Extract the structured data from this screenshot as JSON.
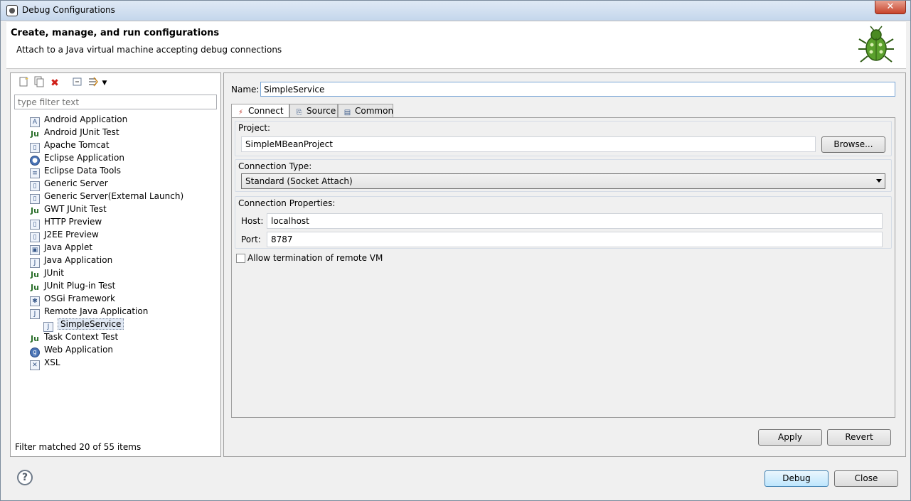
{
  "window": {
    "title": "Debug Configurations",
    "close_glyph": "✕"
  },
  "header": {
    "title": "Create, manage, and run configurations",
    "subtitle": "Attach to a Java virtual machine accepting debug connections"
  },
  "left": {
    "filter_placeholder": "type filter text",
    "status": "Filter matched 20 of 55 items",
    "toolbar_icons": [
      "new-config-icon",
      "duplicate-icon",
      "delete-icon",
      "collapse-all-icon",
      "filter-icon",
      "dropdown-arrow-icon"
    ],
    "tree": [
      {
        "label": "Android Application",
        "icon": "android-app-icon",
        "glyph": "A"
      },
      {
        "label": "Android JUnit Test",
        "icon": "junit-icon",
        "glyph": "Ju"
      },
      {
        "label": "Apache Tomcat",
        "icon": "server-icon",
        "glyph": "▯"
      },
      {
        "label": "Eclipse Application",
        "icon": "eclipse-icon",
        "glyph": "●"
      },
      {
        "label": "Eclipse Data Tools",
        "icon": "database-icon",
        "glyph": "≡"
      },
      {
        "label": "Generic Server",
        "icon": "server-icon",
        "glyph": "▯"
      },
      {
        "label": "Generic Server(External Launch)",
        "icon": "server-icon",
        "glyph": "▯"
      },
      {
        "label": "GWT JUnit Test",
        "icon": "junit-icon",
        "glyph": "Ju"
      },
      {
        "label": "HTTP Preview",
        "icon": "server-icon",
        "glyph": "▯"
      },
      {
        "label": "J2EE Preview",
        "icon": "server-icon",
        "glyph": "▯"
      },
      {
        "label": "Java Applet",
        "icon": "applet-icon",
        "glyph": "▣"
      },
      {
        "label": "Java Application",
        "icon": "java-app-icon",
        "glyph": "J"
      },
      {
        "label": "JUnit",
        "icon": "junit-icon",
        "glyph": "Ju"
      },
      {
        "label": "JUnit Plug-in Test",
        "icon": "junit-icon",
        "glyph": "Ju"
      },
      {
        "label": "OSGi Framework",
        "icon": "osgi-icon",
        "glyph": "✱"
      },
      {
        "label": "Remote Java Application",
        "icon": "remote-java-icon",
        "glyph": "J"
      },
      {
        "label": "SimpleService",
        "icon": "remote-java-icon",
        "glyph": "J",
        "child": true,
        "selected": true
      },
      {
        "label": "Task Context Test",
        "icon": "junit-icon",
        "glyph": "Ju"
      },
      {
        "label": "Web Application",
        "icon": "web-app-icon",
        "glyph": "g"
      },
      {
        "label": "XSL",
        "icon": "xsl-icon",
        "glyph": "✕"
      }
    ]
  },
  "right": {
    "name_label": "Name:",
    "name_value": "SimpleService",
    "tabs": [
      {
        "label": "Connect",
        "icon": "connect-icon",
        "glyph": "⚡",
        "active": true
      },
      {
        "label": "Source",
        "icon": "source-icon",
        "glyph": "⎘"
      },
      {
        "label": "Common",
        "icon": "common-icon",
        "glyph": "▤"
      }
    ],
    "project": {
      "title": "Project:",
      "value": "SimpleMBeanProject",
      "browse_label": "Browse..."
    },
    "connection_type": {
      "title": "Connection Type:",
      "value": "Standard (Socket Attach)"
    },
    "connection_props": {
      "title": "Connection Properties:",
      "host_label": "Host:",
      "host_value": "localhost",
      "port_label": "Port:",
      "port_value": "8787"
    },
    "allow_termination": {
      "label": "Allow termination of remote VM",
      "checked": false
    },
    "apply_label": "Apply",
    "revert_label": "Revert"
  },
  "footer": {
    "help_glyph": "?",
    "debug_label": "Debug",
    "close_label": "Close"
  }
}
